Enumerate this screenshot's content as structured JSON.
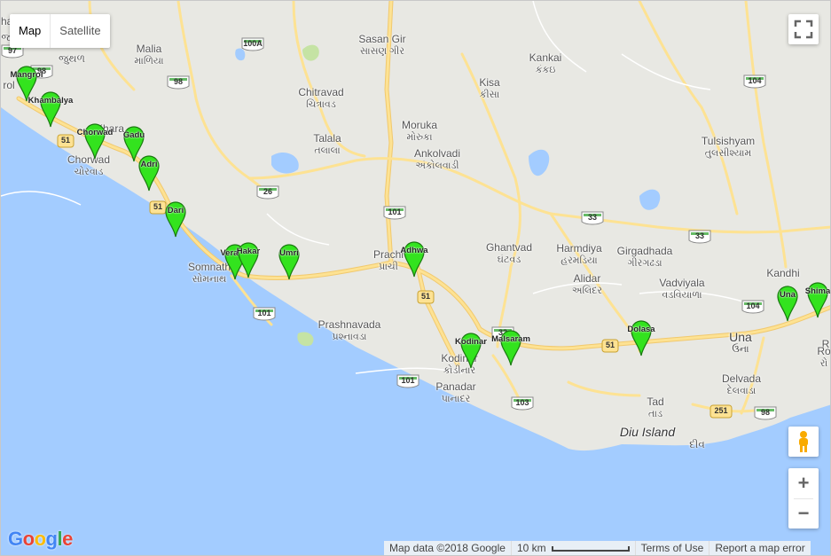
{
  "map": {
    "type_control": {
      "map_label": "Map",
      "satellite_label": "Satellite",
      "selected": "Map"
    },
    "colors": {
      "sea": "#a3ccff",
      "land": "#e8e8e3",
      "road": "#fde293",
      "road_edge": "#f1c96e",
      "marker": "#33e31e",
      "marker_edge": "#1a7a10",
      "park": "#c5e3a4"
    },
    "places": [
      {
        "name": "Sasan Gir",
        "gu": "સાસણ ગીર"
      },
      {
        "name": "Kankai",
        "gu": "કંકઇ"
      },
      {
        "name": "Malia",
        "gu": "માળિયા"
      },
      {
        "name": "Kisa",
        "gu": "કીસા"
      },
      {
        "name": "Chitravad",
        "gu": "ચિત્રાવડ"
      },
      {
        "name": "Moruka",
        "gu": "મોરુકા"
      },
      {
        "name": "Talala",
        "gu": "તલાલા"
      },
      {
        "name": "Ankolvadi",
        "gu": "અંકોલવાડી"
      },
      {
        "name": "Tulsishyam",
        "gu": "તુલસીશ્યામ"
      },
      {
        "name": "Chorwad",
        "gu": "ચોરવાડ"
      },
      {
        "name": "Ghantvad",
        "gu": "ઘંટવડ"
      },
      {
        "name": "Harmdiya",
        "gu": "હરમડિયા"
      },
      {
        "name": "Girgadhada",
        "gu": "ગીરગઢડા"
      },
      {
        "name": "Alidar",
        "gu": "અલિદર"
      },
      {
        "name": "Vadviyala",
        "gu": "વડવિયાળા"
      },
      {
        "name": "Kandhi",
        "gu": ""
      },
      {
        "name": "Somnath",
        "gu": "સોમનાથ"
      },
      {
        "name": "Prachi",
        "gu": "પ્રાચી"
      },
      {
        "name": "Prashnavada",
        "gu": "પ્રશ્નાવડા"
      },
      {
        "name": "Una",
        "gu": "ઉના"
      },
      {
        "name": "Kodinar",
        "gu": "કોડીનાર"
      },
      {
        "name": "Panadar",
        "gu": "પાનાદર"
      },
      {
        "name": "Delvada",
        "gu": "દેલવાડા"
      },
      {
        "name": "Tad",
        "gu": "તાડ"
      },
      {
        "name": "Diu Island",
        "gu": "દીવ"
      },
      {
        "name": "Kharа",
        "gu": "ખારા"
      },
      {
        "name": "haj",
        "gu": ""
      },
      {
        "name": "rol",
        "gu": ""
      },
      {
        "name": "R",
        "gu": ""
      },
      {
        "name": "Ro",
        "gu": "રો"
      },
      {
        "name": "જ",
        "gu": ""
      },
      {
        "name": "જુથળ",
        "gu": ""
      }
    ],
    "road_shields": [
      "100A",
      "98",
      "26",
      "101",
      "33",
      "104",
      "33",
      "101",
      "51",
      "51",
      "51",
      "32",
      "51",
      "101",
      "103",
      "104",
      "251",
      "98",
      "97",
      "98"
    ],
    "markers": [
      "Mangrol",
      "Khambalya",
      "Chorwad",
      "Gadu",
      "Adri",
      "Dari",
      "Veraval",
      "Hakar",
      "Umri",
      "Adhwa",
      "Kodinar",
      "Malsaram",
      "Dolasa",
      "Una",
      "Shima"
    ],
    "footer": {
      "map_data": "Map data ©2018 Google",
      "scale": "10 km",
      "terms": "Terms of Use",
      "report": "Report a map error"
    },
    "logo": "Google",
    "logo_colors": [
      "#4285f4",
      "#ea4335",
      "#fbbc05",
      "#4285f4",
      "#34a853",
      "#ea4335"
    ],
    "icons": {
      "fullscreen": "fullscreen-icon",
      "pegman": "pegman-icon",
      "zoom_in": "+",
      "zoom_out": "−"
    }
  }
}
